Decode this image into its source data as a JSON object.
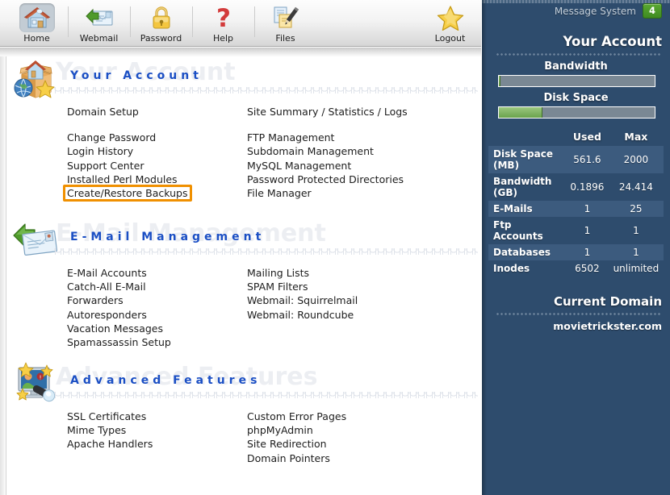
{
  "toolbar": {
    "items": [
      {
        "label": "Home",
        "icon": "home-icon",
        "selected": true
      },
      {
        "label": "Webmail",
        "icon": "webmail-envelope-icon",
        "selected": false
      },
      {
        "label": "Password",
        "icon": "padlock-icon",
        "selected": false
      },
      {
        "label": "Help",
        "icon": "question-mark-icon",
        "selected": false
      },
      {
        "label": "Files",
        "icon": "documents-pen-icon",
        "selected": false
      }
    ],
    "logout": {
      "label": "Logout",
      "icon": "star-icon"
    }
  },
  "sections": [
    {
      "title": "Your Account",
      "icon": "house-box-globe-star-icon",
      "col1": [
        {
          "label": "Domain Setup",
          "gap_after": true
        },
        {
          "label": "Change Password"
        },
        {
          "label": "Login History"
        },
        {
          "label": "Support Center"
        },
        {
          "label": "Installed Perl Modules"
        },
        {
          "label": "Create/Restore Backups",
          "highlighted": true
        }
      ],
      "col2": [
        {
          "label": "Site Summary / Statistics / Logs",
          "gap_after": true
        },
        {
          "label": "FTP Management"
        },
        {
          "label": "Subdomain Management"
        },
        {
          "label": "MySQL Management"
        },
        {
          "label": "Password Protected Directories"
        },
        {
          "label": "File Manager"
        }
      ]
    },
    {
      "title": "E-Mail Management",
      "icon": "envelope-arrow-icon",
      "col1": [
        {
          "label": "E-Mail Accounts"
        },
        {
          "label": "Catch-All E-Mail"
        },
        {
          "label": "Forwarders"
        },
        {
          "label": "Autoresponders"
        },
        {
          "label": "Vacation Messages"
        },
        {
          "label": "Spamassassin Setup"
        }
      ],
      "col2": [
        {
          "label": "Mailing Lists"
        },
        {
          "label": "SPAM Filters"
        },
        {
          "label": "Webmail: Squirrelmail"
        },
        {
          "label": "Webmail: Roundcube"
        }
      ]
    },
    {
      "title": "Advanced Features",
      "icon": "monitor-stars-icon",
      "col1": [
        {
          "label": "SSL Certificates"
        },
        {
          "label": "Mime Types"
        },
        {
          "label": "Apache Handlers"
        }
      ],
      "col2": [
        {
          "label": "Custom Error Pages"
        },
        {
          "label": "phpMyAdmin"
        },
        {
          "label": "Site Redirection"
        },
        {
          "label": "Domain Pointers"
        }
      ]
    }
  ],
  "sidebar": {
    "message_system": {
      "label": "Message System",
      "count": "4"
    },
    "account_title": "Your Account",
    "bandwidth": {
      "label": "Bandwidth",
      "percent": 1
    },
    "disk_space": {
      "label": "Disk Space",
      "percent": 28
    },
    "table": {
      "headers": [
        "",
        "Used",
        "Max"
      ],
      "rows": [
        {
          "label": "Disk Space (MB)",
          "used": "561.6",
          "max": "2000"
        },
        {
          "label": "Bandwidth (GB)",
          "used": "0.1896",
          "max": "24.414"
        },
        {
          "label": "E-Mails",
          "used": "1",
          "max": "25"
        },
        {
          "label": "Ftp Accounts",
          "used": "1",
          "max": "1"
        },
        {
          "label": "Databases",
          "used": "1",
          "max": "1"
        },
        {
          "label": "Inodes",
          "used": "6502",
          "max": "unlimited"
        }
      ]
    },
    "current_domain_title": "Current Domain",
    "current_domain": "movietrickster.com"
  },
  "colors": {
    "sidebar_bg": "#2e4c6d",
    "sidebar_alt_row": "#3c5b7e",
    "accent_blue": "#1b4fc4",
    "highlight_orange": "#f09000",
    "badge_green": "#4f9a2a"
  }
}
